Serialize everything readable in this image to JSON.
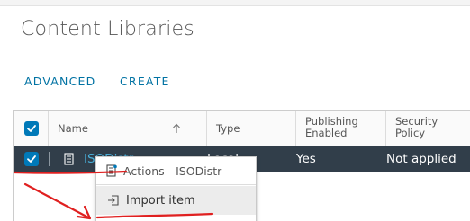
{
  "page": {
    "title": "Content Libraries"
  },
  "toolbar": {
    "advanced_label": "ADVANCED",
    "create_label": "CREATE"
  },
  "grid": {
    "columns": [
      {
        "id": "name",
        "label": "Name",
        "sortable": true
      },
      {
        "id": "type",
        "label": "Type"
      },
      {
        "id": "publishing",
        "label": "Publishing\nEnabled"
      },
      {
        "id": "security",
        "label": "Security\nPolicy"
      }
    ],
    "rows": [
      {
        "selected": true,
        "name": "ISODistr",
        "type": "Local",
        "publishing_enabled": "Yes",
        "security_policy": "Not applied"
      }
    ]
  },
  "context_menu": {
    "title": "Actions - ISODistr",
    "items": [
      {
        "label": "Import item",
        "icon": "import-icon"
      }
    ]
  },
  "colors": {
    "accent": "#0072a3",
    "checkbox": "#0079b8",
    "selected_row": "#313e4a",
    "annotation_red": "#e02020"
  }
}
